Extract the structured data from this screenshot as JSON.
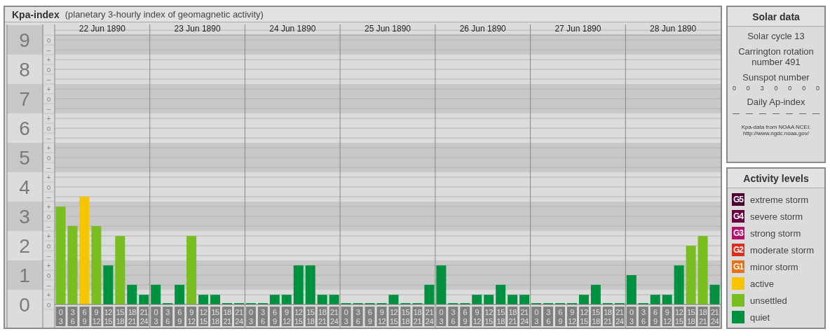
{
  "chart_panel": {
    "title": "Kpa-index",
    "subtitle": "(planetary 3-hourly index of geomagnetic activity)",
    "days": [
      "22 Jun 1890",
      "23 Jun 1890",
      "24 Jun 1890",
      "25 Jun 1890",
      "26 Jun 1890",
      "27 Jun 1890",
      "28 Jun 1890"
    ],
    "sub_labels": [
      "o",
      "–",
      "+",
      "o",
      "–",
      "+",
      "o",
      "–",
      "+",
      "o",
      "–",
      "+",
      "o",
      "–",
      "+",
      "o",
      "–",
      "+",
      "o",
      "–",
      "+",
      "o",
      "–",
      "+",
      "o",
      "–",
      "+",
      "o"
    ],
    "chart_data": {
      "type": "bar",
      "grid": true,
      "ylim": [
        0,
        9.17
      ],
      "yticks": [
        0,
        1,
        2,
        3,
        4,
        5,
        6,
        7,
        8,
        9
      ],
      "categories": [
        "0 3",
        "3 6",
        "6 9",
        "9 12",
        "12 15",
        "15 18",
        "18 21",
        "21 24",
        "0 3",
        "3 6",
        "6 9",
        "9 12",
        "12 15",
        "15 18",
        "18 21",
        "21 24",
        "0 3",
        "3 6",
        "6 9",
        "9 12",
        "12 15",
        "15 18",
        "18 21",
        "21 24",
        "0 3",
        "3 6",
        "6 9",
        "9 12",
        "12 15",
        "15 18",
        "18 21",
        "21 24",
        "0 3",
        "3 6",
        "6 9",
        "9 12",
        "12 15",
        "15 18",
        "18 21",
        "21 24",
        "0 3",
        "3 6",
        "6 9",
        "9 12",
        "12 15",
        "15 18",
        "18 21",
        "21 24",
        "0 3",
        "3 6",
        "6 9",
        "9 12",
        "12 15",
        "15 18",
        "18 21",
        "21 24"
      ],
      "series": [
        {
          "color": "#009140",
          "values": [
            null,
            null,
            null,
            null,
            1.33,
            null,
            0.67,
            0.33,
            0.67,
            0,
            0.67,
            null,
            0.33,
            0.33,
            0,
            0,
            0,
            0,
            0.33,
            0.33,
            1.33,
            1.33,
            0.33,
            0.33,
            0,
            0,
            0,
            0,
            0.33,
            0,
            0,
            0.67,
            1.33,
            0,
            0,
            0.33,
            0.33,
            0.67,
            0.33,
            0.33,
            0,
            0,
            0,
            0,
            0.33,
            0.67,
            0,
            0,
            1,
            0,
            0.33,
            0.33,
            1.33,
            null,
            null,
            0.67
          ]
        },
        {
          "color": "#78be21",
          "values": [
            3.33,
            2.67,
            null,
            2.67,
            null,
            2.33,
            null,
            null,
            null,
            null,
            null,
            2.33,
            null,
            null,
            null,
            null,
            null,
            null,
            null,
            null,
            null,
            null,
            null,
            null,
            null,
            null,
            null,
            null,
            null,
            null,
            null,
            null,
            null,
            null,
            null,
            null,
            null,
            null,
            null,
            null,
            null,
            null,
            null,
            null,
            null,
            null,
            null,
            null,
            null,
            null,
            null,
            null,
            null,
            2,
            2.33,
            null
          ]
        },
        {
          "color": "#f7c400",
          "values": [
            null,
            null,
            3.67,
            null,
            null,
            null,
            null,
            null,
            null,
            null,
            null,
            null,
            null,
            null,
            null,
            null,
            null,
            null,
            null,
            null,
            null,
            null,
            null,
            null,
            null,
            null,
            null,
            null,
            null,
            null,
            null,
            null,
            null,
            null,
            null,
            null,
            null,
            null,
            null,
            null,
            null,
            null,
            null,
            null,
            null,
            null,
            null,
            null,
            null,
            null,
            null,
            null,
            null,
            null,
            null,
            null
          ]
        }
      ]
    }
  },
  "solar_data": {
    "title": "Solar data",
    "solar_cycle": "Solar cycle 13",
    "carrington": "Carrington rotation number 491",
    "sunspot_heading": "Sunspot number",
    "sunspots": [
      "0",
      "0",
      "3",
      "0",
      "0",
      "0",
      "0"
    ],
    "ap_heading": "Daily Ap-index",
    "ap_values": [
      "—",
      "—",
      "—",
      "—",
      "—",
      "—",
      "—"
    ],
    "source": "Kpa-data from NOAA NCEI:",
    "source_url": "http://www.ngdc.noaa.gov/"
  },
  "activity_levels": {
    "title": "Activity levels",
    "items": [
      {
        "badge": "G5",
        "label": "extreme storm",
        "color": "#4a0030"
      },
      {
        "badge": "G4",
        "label": "severe storm",
        "color": "#6a0040"
      },
      {
        "badge": "G3",
        "label": "strong storm",
        "color": "#b0106a"
      },
      {
        "badge": "G2",
        "label": "moderate storm",
        "color": "#d8301e"
      },
      {
        "badge": "G1",
        "label": "minor storm",
        "color": "#e4731a"
      },
      {
        "label": "active",
        "color": "#f7c400"
      },
      {
        "label": "unsettled",
        "color": "#78be21"
      },
      {
        "label": "quiet",
        "color": "#009140"
      }
    ]
  }
}
